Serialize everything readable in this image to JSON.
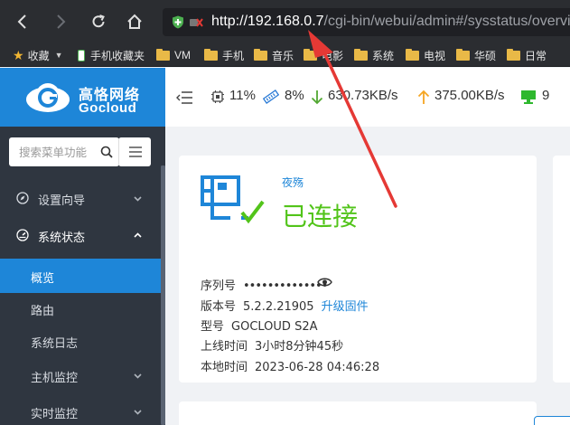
{
  "browser": {
    "url_host": "http://192.168.0.7",
    "url_path": "/cgi-bin/webui/admin#/sysstatus/overview"
  },
  "bookmarks": [
    {
      "label": "收藏",
      "kind": "star"
    },
    {
      "label": "手机收藏夹",
      "kind": "phone"
    },
    {
      "label": "VM",
      "kind": "folder"
    },
    {
      "label": "手机",
      "kind": "folder"
    },
    {
      "label": "音乐",
      "kind": "folder"
    },
    {
      "label": "电影",
      "kind": "folder"
    },
    {
      "label": "系统",
      "kind": "folder"
    },
    {
      "label": "电视",
      "kind": "folder"
    },
    {
      "label": "华硕",
      "kind": "folder"
    },
    {
      "label": "日常",
      "kind": "folder"
    }
  ],
  "brand": {
    "name_cn": "高恪网络",
    "name_en": "Gocloud"
  },
  "sidebar": {
    "search_placeholder": "搜索菜单功能",
    "items": [
      {
        "label": "设置向导"
      },
      {
        "label": "系统状态"
      },
      {
        "label": "概览"
      },
      {
        "label": "路由"
      },
      {
        "label": "系统日志"
      },
      {
        "label": "主机监控"
      },
      {
        "label": "实时监控"
      }
    ]
  },
  "status": {
    "cpu": "11%",
    "memory": "8%",
    "download": "630.73KB/s",
    "upload": "375.00KB/s",
    "hosts": "9"
  },
  "device": {
    "name": "夜殇",
    "state": "已连接",
    "serial_label": "序列号",
    "serial_value": "••••••••••••••",
    "version_label": "版本号",
    "version_value": "5.2.2.21905",
    "upgrade_link": "升级固件",
    "model_label": "型号",
    "model_value": "GOCLOUD S2A",
    "uptime_label": "上线时间",
    "uptime_value": "3小时8分钟45秒",
    "localtime_label": "本地时间",
    "localtime_value": "2023-06-28 04:46:28"
  },
  "colors": {
    "accent": "#1e86d8",
    "connected": "#52c41a",
    "sidebar_bg": "#2f3640",
    "annotation": "#e53935"
  }
}
